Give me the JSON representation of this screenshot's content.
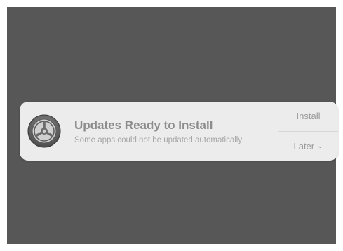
{
  "notification": {
    "icon": "system-preferences-gear-icon",
    "title": "Updates Ready to Install",
    "body": "Some apps could not be updated automatically",
    "actions": {
      "install_label": "Install",
      "later_label": "Later",
      "later_chevron": "⌄"
    }
  },
  "colors": {
    "backdrop": "#575757",
    "panel": "#ececec",
    "title_text": "#8c8c8c",
    "body_text": "#a6a6a6"
  }
}
